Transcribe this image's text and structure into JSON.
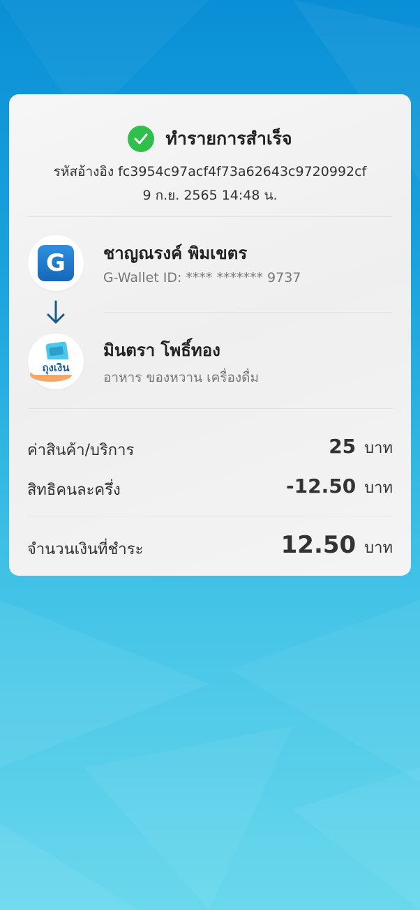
{
  "receipt": {
    "status": "ทำรายการสำเร็จ",
    "reference": "รหัสอ้างอิง fc3954c97acf4f73a62643c9720992cf",
    "datetime": "9 ก.ย. 2565 14:48 น."
  },
  "sender": {
    "logo_letter": "G",
    "name": "ชาญณรงค์ พิมเขตร",
    "wallet_id": "G-Wallet ID: **** ******* 9737"
  },
  "recipient": {
    "logo_text": "ถุงเงิน",
    "name": "มินตรา โพธิ์ทอง",
    "category": "อาหาร ของหวาน เครื่องดื่ม"
  },
  "items": [
    {
      "label": "ค่าสินค้า/บริการ",
      "amount": "25",
      "unit": "บาท"
    },
    {
      "label": "สิทธิคนละครึ่ง",
      "amount": "-12.50",
      "unit": "บาท"
    }
  ],
  "total": {
    "label": "จำนวนเงินที่ชำระ",
    "amount": "12.50",
    "unit": "บาท"
  },
  "colors": {
    "success": "#2fbf4a",
    "wallet_blue": "#1667b8",
    "arrow": "#1a5b85"
  }
}
